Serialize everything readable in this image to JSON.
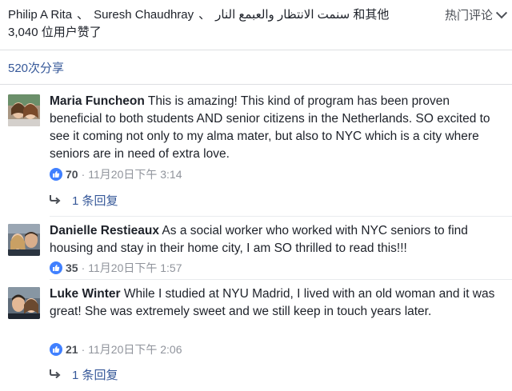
{
  "header": {
    "likers": {
      "name1": "Philip A Rita",
      "sep1": "、",
      "name2": "Suresh Chaudhray",
      "sep2": "、",
      "name3": "سنمت الانتظار والعبمع النار",
      "suffix": "和其他",
      "count_line": "3,040 位用户赞了"
    },
    "sort_label": "热门评论",
    "share_label": "520次分享"
  },
  "comments": [
    {
      "author": "Maria Funcheon",
      "text": " This is amazing! This kind of program has been proven beneficial to both students AND senior citizens in the Netherlands. SO excited to see it coming not only to my alma mater, but also to NYC which is a city where seniors are in need of extra love.",
      "likes": "70",
      "separator": "·",
      "timestamp": "11月20日下午 3:14",
      "reply_label": "1 条回复"
    },
    {
      "author": "Danielle Restieaux",
      "text": " As a social worker who worked with NYC seniors to find housing and stay in their home city, I am SO thrilled to read this!!!",
      "likes": "35",
      "separator": "·",
      "timestamp": "11月20日下午 1:57"
    },
    {
      "author": "Luke Winter",
      "text": " While I studied at NYU Madrid, I lived with an old woman and it was great! She was extremely sweet and we still keep in touch years later.",
      "likes": "21",
      "separator": "·",
      "timestamp": "11月20日下午 2:06",
      "reply_label": "1 条回复"
    }
  ],
  "colors": {
    "link": "#365899",
    "like_badge": "#4080ff",
    "meta_text": "#90949c"
  },
  "icons": {
    "sort": "chevron-down-icon",
    "like": "thumbs-up-icon",
    "reply": "reply-arrow-icon"
  }
}
